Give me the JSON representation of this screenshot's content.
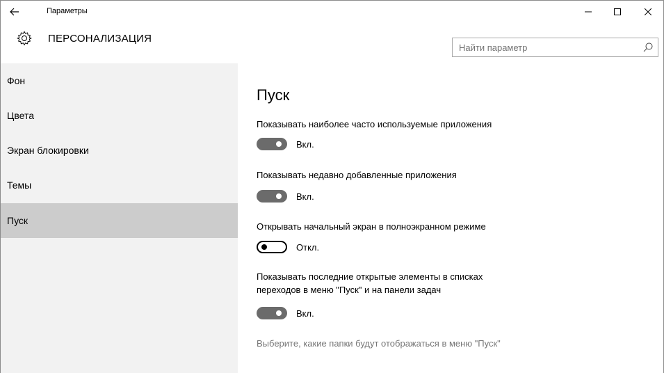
{
  "window": {
    "title": "Параметры"
  },
  "header": {
    "section_title": "ПЕРСОНАЛИЗАЦИЯ",
    "search_placeholder": "Найти параметр"
  },
  "sidebar": {
    "items": [
      {
        "label": "Фон",
        "active": false
      },
      {
        "label": "Цвета",
        "active": false
      },
      {
        "label": "Экран блокировки",
        "active": false
      },
      {
        "label": "Темы",
        "active": false
      },
      {
        "label": "Пуск",
        "active": true
      }
    ]
  },
  "content": {
    "heading": "Пуск",
    "settings": [
      {
        "label": "Показывать наиболее часто используемые приложения",
        "state": "on",
        "state_text": "Вкл."
      },
      {
        "label": "Показывать недавно добавленные приложения",
        "state": "on",
        "state_text": "Вкл."
      },
      {
        "label": "Открывать начальный экран в полноэкранном режиме",
        "state": "off",
        "state_text": "Откл."
      },
      {
        "label_line1": "Показывать последние открытые элементы в списках",
        "label_line2": "переходов в меню \"Пуск\" и на панели задач",
        "state": "on",
        "state_text": "Вкл."
      }
    ],
    "folders_link": "Выберите, какие папки будут отображаться в меню \"Пуск\""
  },
  "colors": {
    "sidebar_bg": "#f2f2f2",
    "active_item_bg": "#cccccc",
    "toggle_on": "#6b6b6b",
    "link_gray": "#767676"
  }
}
